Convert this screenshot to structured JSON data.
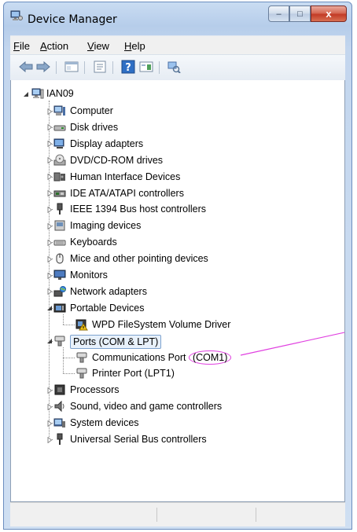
{
  "window": {
    "title": "Device Manager",
    "buttons": {
      "minimize": "–",
      "maximize": "□",
      "close": "x"
    }
  },
  "menu": [
    {
      "key": "file",
      "accel": "F",
      "rest": "ile"
    },
    {
      "key": "action",
      "accel": "A",
      "rest": "ction"
    },
    {
      "key": "view",
      "accel": "V",
      "rest": "iew"
    },
    {
      "key": "help",
      "accel": "H",
      "rest": "elp"
    }
  ],
  "toolbar": {
    "icons": [
      "back-arrow-icon",
      "forward-arrow-icon",
      "show-hide-tree-icon",
      "properties-icon",
      "help-icon",
      "console-tree-icon",
      "scan-hardware-icon"
    ]
  },
  "tree": {
    "root": "IAN09",
    "items": [
      {
        "label": "Computer",
        "icon": "computer-icon",
        "expander": "collapsed"
      },
      {
        "label": "Disk drives",
        "icon": "disk-drive-icon",
        "expander": "collapsed"
      },
      {
        "label": "Display adapters",
        "icon": "display-adapter-icon",
        "expander": "collapsed"
      },
      {
        "label": "DVD/CD-ROM drives",
        "icon": "dvd-drive-icon",
        "expander": "collapsed"
      },
      {
        "label": "Human Interface Devices",
        "icon": "hid-icon",
        "expander": "collapsed"
      },
      {
        "label": "IDE ATA/ATAPI controllers",
        "icon": "ide-controller-icon",
        "expander": "collapsed"
      },
      {
        "label": "IEEE 1394 Bus host controllers",
        "icon": "ieee1394-icon",
        "expander": "collapsed"
      },
      {
        "label": "Imaging devices",
        "icon": "imaging-device-icon",
        "expander": "collapsed"
      },
      {
        "label": "Keyboards",
        "icon": "keyboard-icon",
        "expander": "collapsed"
      },
      {
        "label": "Mice and other pointing devices",
        "icon": "mouse-icon",
        "expander": "collapsed"
      },
      {
        "label": "Monitors",
        "icon": "monitor-icon",
        "expander": "collapsed"
      },
      {
        "label": "Network adapters",
        "icon": "network-adapter-icon",
        "expander": "collapsed"
      },
      {
        "label": "Portable Devices",
        "icon": "portable-device-icon",
        "expander": "expanded"
      },
      {
        "label": "WPD FileSystem Volume Driver",
        "icon": "wpd-driver-warning-icon",
        "child": true
      },
      {
        "label": "Ports (COM & LPT)",
        "icon": "port-icon",
        "expander": "expanded",
        "selected": true
      },
      {
        "label": "Communications Port (COM1)",
        "icon": "com-port-icon",
        "child": true,
        "prefix": "Communications Port ",
        "circled": "(COM1)"
      },
      {
        "label": "Printer Port (LPT1)",
        "icon": "printer-port-icon",
        "child": true
      },
      {
        "label": "Processors",
        "icon": "processor-icon",
        "expander": "collapsed"
      },
      {
        "label": "Sound, video and game controllers",
        "icon": "sound-icon",
        "expander": "collapsed"
      },
      {
        "label": "System devices",
        "icon": "system-device-icon",
        "expander": "collapsed"
      },
      {
        "label": "Universal Serial Bus controllers",
        "icon": "usb-icon",
        "expander": "collapsed"
      }
    ]
  },
  "colors": {
    "annotation": "#e040e0",
    "selection_border": "#7da2ce"
  }
}
